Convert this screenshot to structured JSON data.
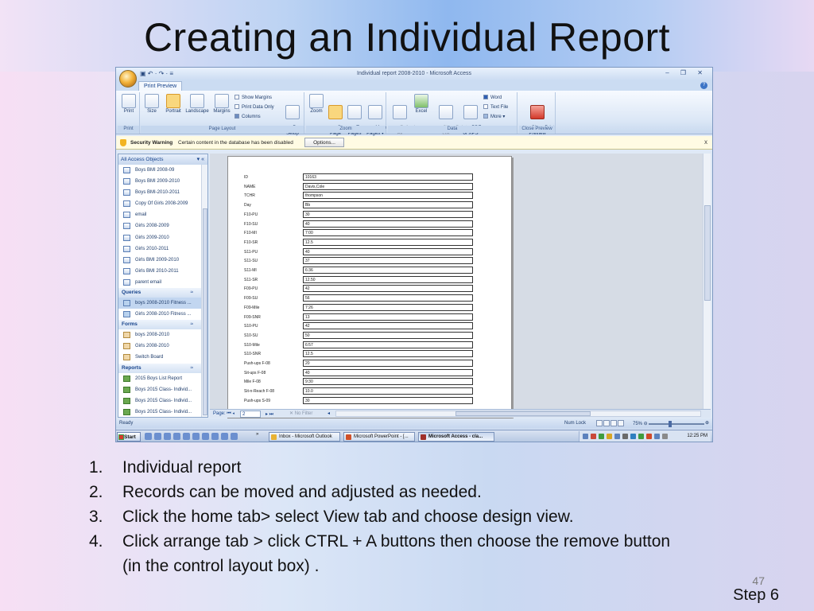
{
  "slide": {
    "title": "Creating an Individual Report",
    "page_number": "47",
    "step_label": "Step 6",
    "steps": [
      {
        "num": "1.",
        "text": "Individual report"
      },
      {
        "num": "2.",
        "text": "Records can be moved and adjusted as needed."
      },
      {
        "num": "3.",
        "text": "Click the home tab> select View tab and choose design view."
      },
      {
        "num": "4.",
        "text": "Click arrange tab > click CTRL + A buttons then choose the remove button"
      }
    ],
    "step4_continuation": "(in the control layout box) ."
  },
  "window": {
    "title": "Individual report 2008-2010 - Microsoft Access",
    "qat": "▣ ↶ · ↷ · ≡",
    "controls": "– ❐ ✕",
    "tab_label": "Print Preview",
    "help": "?"
  },
  "ribbon": {
    "print": {
      "button": "Print",
      "group": "Print"
    },
    "page_layout": {
      "buttons": [
        "Size",
        "Portrait",
        "Landscape",
        "Margins",
        "Page\nSetup"
      ],
      "options": [
        "Show Margins",
        "Print Data Only",
        "Columns"
      ],
      "group": "Page Layout"
    },
    "zoom": {
      "buttons": [
        "Zoom",
        "One\nPage",
        "Two\nPages",
        "More\nPages ▾"
      ],
      "group": "Zoom"
    },
    "data": {
      "buttons": [
        "Refresh\nAll",
        "Excel",
        "SharePoint\nList",
        "PDF\nor XPS"
      ],
      "options": [
        "Word",
        "Text File",
        "More ▾"
      ],
      "group": "Data"
    },
    "close_preview": {
      "button": "Close Print\nPreview",
      "group": "Close Preview"
    }
  },
  "security": {
    "label": "Security Warning",
    "message": "Certain content in the database has been disabled",
    "options_button": "Options...",
    "close": "x"
  },
  "nav": {
    "header": "All Access Objects",
    "header_arrows": "▾  «",
    "tables": [
      "Boys BMI 2008-09",
      "Boys BMI 2009-2010",
      "Boys BMI-2010-2011",
      "Copy Of Girls 2008-2009",
      "email",
      "Girls 2008-2009",
      "Girls 2009-2010",
      "Girls 2010-2011",
      "Girls BMI 2009-2010",
      "Girls BMI 2010-2011",
      "parent email"
    ],
    "queries_label": "Queries",
    "queries": [
      "boys 2008-2010 Fitness ...",
      "Girls 2008-2010 Fitness ..."
    ],
    "forms_label": "Forms",
    "forms": [
      "boys 2008-2010",
      "Girls 2008-2010",
      "Switch Board"
    ],
    "reports_label": "Reports",
    "reports": [
      "2015 Boys List Report",
      "Boys 2015 Class- Individ...",
      "Boys 2015 Class- Individ...",
      "Boys 2015 Class- Individ..."
    ],
    "chevron": "≈"
  },
  "report_fields": [
    {
      "label": "ID",
      "value": "10163"
    },
    {
      "label": "NAME",
      "value": "Davis,Cole"
    },
    {
      "label": "TCHR",
      "value": "thompson"
    },
    {
      "label": "Day",
      "value": "Bb"
    },
    {
      "label": "F10-PU",
      "value": "30"
    },
    {
      "label": "F10-SU",
      "value": "40"
    },
    {
      "label": "F10-MI",
      "value": "7:00"
    },
    {
      "label": "F10-SR",
      "value": "12.5"
    },
    {
      "label": "S11-PU",
      "value": "40"
    },
    {
      "label": "S11-SU",
      "value": "37"
    },
    {
      "label": "S11-MI",
      "value": "6:36"
    },
    {
      "label": "S11-SR",
      "value": "12.50"
    },
    {
      "label": "F09-PU",
      "value": "42"
    },
    {
      "label": "F09-SU",
      "value": "56"
    },
    {
      "label": "F09-Mile",
      "value": "7:26"
    },
    {
      "label": "F09-SNR",
      "value": "13"
    },
    {
      "label": "S10-PU",
      "value": "42"
    },
    {
      "label": "S10-SU",
      "value": "50"
    },
    {
      "label": "S10-Mile",
      "value": "6:57"
    },
    {
      "label": "S10-SNR",
      "value": "12.5"
    },
    {
      "label": "Push-ups F-08",
      "value": "20"
    },
    {
      "label": "Sit-ups F-08",
      "value": "40"
    },
    {
      "label": "Mile F-08",
      "value": "9:30"
    },
    {
      "label": "Sit-n-Reach F-08",
      "value": "10.0"
    },
    {
      "label": "Push-ups S-09",
      "value": "30"
    }
  ],
  "pager": {
    "label": "Page: ⏮ ◂",
    "current": "2",
    "after": "▸ ⏭",
    "no_filter": "✕ No Filter",
    "scroll_arrow": "◂"
  },
  "statusbar": {
    "ready": "Ready",
    "num_lock": "Num Lock",
    "zoom": "75%  ⊖",
    "zoom_plus": "⊕"
  },
  "taskbar": {
    "start": "Start",
    "more": "»",
    "buttons": [
      "Inbox - Microsoft Outlook",
      "Microsoft PowerPoint - [...",
      "Microsoft Access - cla..."
    ],
    "clock": "12:25 PM"
  }
}
